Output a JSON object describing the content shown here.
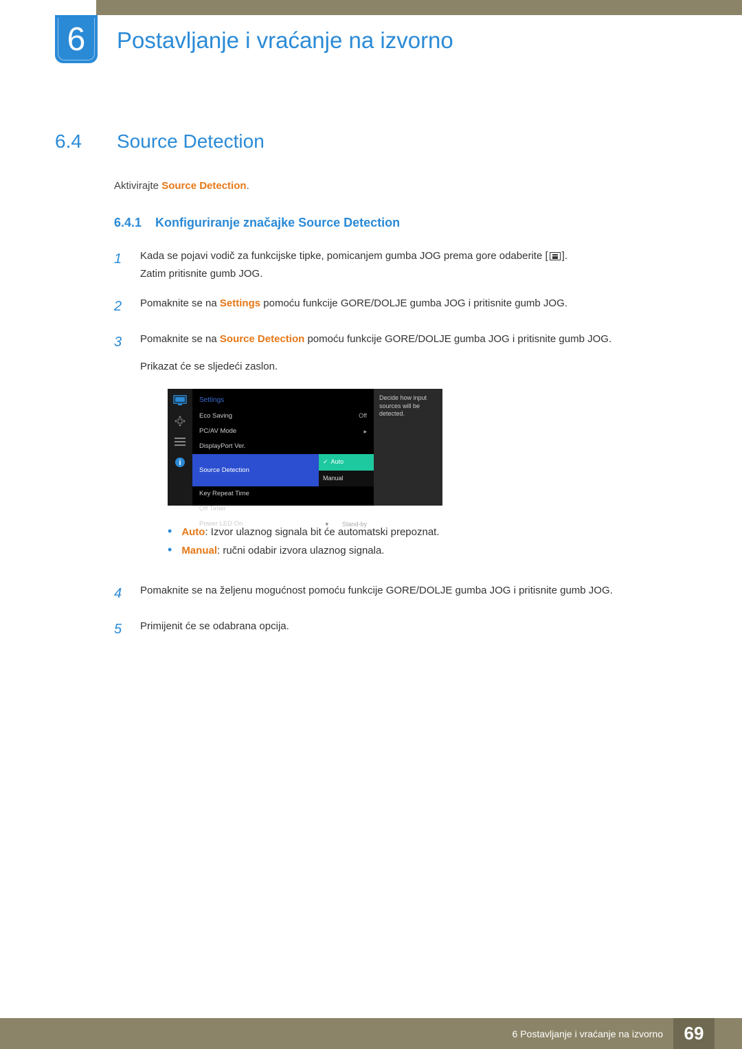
{
  "chapter": {
    "number": "6",
    "title": "Postavljanje i vraćanje na izvorno"
  },
  "section": {
    "number": "6.4",
    "title": "Source Detection"
  },
  "intro": {
    "prefix": "Aktivirajte ",
    "hl": "Source Detection",
    "suffix": "."
  },
  "subsection": {
    "number": "6.4.1",
    "title": "Konfiguriranje značajke Source Detection"
  },
  "steps": {
    "s1": {
      "num": "1",
      "line1a": "Kada se pojavi vodič za funkcijske tipke, pomicanjem gumba JOG prema gore odaberite [",
      "line1b": "].",
      "line2": "Zatim pritisnite gumb JOG."
    },
    "s2": {
      "num": "2",
      "a": "Pomaknite se na ",
      "hl": "Settings",
      "b": " pomoću funkcije GORE/DOLJE gumba JOG i pritisnite gumb JOG."
    },
    "s3": {
      "num": "3",
      "a": "Pomaknite se na ",
      "hl": "Source Detection",
      "b": " pomoću funkcije GORE/DOLJE gumba JOG i pritisnite gumb JOG.",
      "line2": "Prikazat će se sljedeći zaslon."
    },
    "s4": {
      "num": "4",
      "text": "Pomaknite se na željenu mogućnost pomoću funkcije GORE/DOLJE gumba JOG i pritisnite gumb JOG."
    },
    "s5": {
      "num": "5",
      "text": "Primijenit će se odabrana opcija."
    }
  },
  "osd": {
    "title": "Settings",
    "rows": {
      "eco": {
        "label": "Eco Saving",
        "val": "Off"
      },
      "pcav": {
        "label": "PC/AV Mode",
        "val": "▸"
      },
      "dp": {
        "label": "DisplayPort Ver."
      },
      "sd": {
        "label": "Source Detection"
      },
      "krt": {
        "label": "Key Repeat Time"
      },
      "ot": {
        "label": "Off Timer"
      },
      "pled": {
        "label": "Power LED On",
        "val": "Stand-by"
      }
    },
    "submenu": {
      "auto": "Auto",
      "manual": "Manual"
    },
    "help": "Decide how input sources will be detected."
  },
  "bullets": {
    "auto": {
      "hl": "Auto",
      "text": ": Izvor ulaznog signala bit će automatski prepoznat."
    },
    "manual": {
      "hl": "Manual",
      "text": ": ručni odabir izvora ulaznog signala."
    }
  },
  "footer": {
    "text": "6 Postavljanje i vraćanje na izvorno",
    "page": "69"
  }
}
